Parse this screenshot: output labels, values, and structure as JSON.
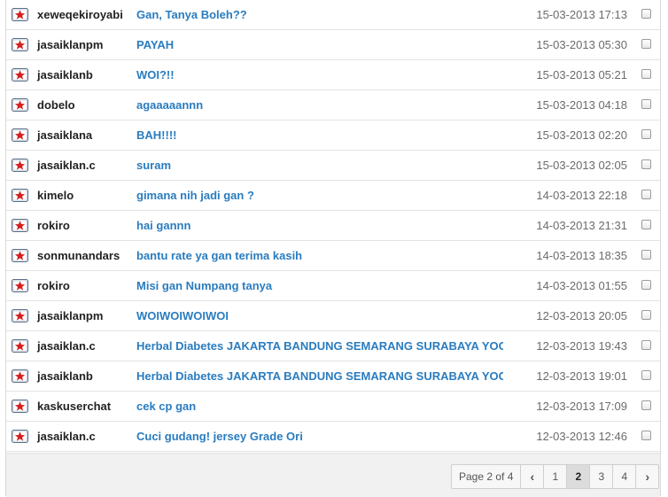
{
  "messages": [
    {
      "sender": "xeweqekiroyabi",
      "subject": "Gan, Tanya Boleh??",
      "date": "15-03-2013 17:13"
    },
    {
      "sender": "jasaiklanpm",
      "subject": "PAYAH",
      "date": "15-03-2013 05:30"
    },
    {
      "sender": "jasaiklanb",
      "subject": "WOI?!!",
      "date": "15-03-2013 05:21"
    },
    {
      "sender": "dobelo",
      "subject": "agaaaaannn",
      "date": "15-03-2013 04:18"
    },
    {
      "sender": "jasaiklana",
      "subject": "BAH!!!!",
      "date": "15-03-2013 02:20"
    },
    {
      "sender": "jasaiklan.c",
      "subject": "suram",
      "date": "15-03-2013 02:05"
    },
    {
      "sender": "kimelo",
      "subject": "gimana nih jadi gan ?",
      "date": "14-03-2013 22:18"
    },
    {
      "sender": "rokiro",
      "subject": "hai gannn",
      "date": "14-03-2013 21:31"
    },
    {
      "sender": "sonmunandars",
      "subject": "bantu rate ya gan terima kasih",
      "date": "14-03-2013 18:35"
    },
    {
      "sender": "rokiro",
      "subject": "Misi gan Numpang tanya",
      "date": "14-03-2013 01:55"
    },
    {
      "sender": "jasaiklanpm",
      "subject": "WOIWOIWOIWOI",
      "date": "12-03-2013 20:05"
    },
    {
      "sender": "jasaiklan.c",
      "subject": "Herbal Diabetes JAKARTA BANDUNG SEMARANG SURABAYA YOGYA",
      "date": "12-03-2013 19:43"
    },
    {
      "sender": "jasaiklanb",
      "subject": "Herbal Diabetes JAKARTA BANDUNG SEMARANG SURABAYA YOGYA",
      "date": "12-03-2013 19:01"
    },
    {
      "sender": "kaskuserchat",
      "subject": "cek cp gan",
      "date": "12-03-2013 17:09"
    },
    {
      "sender": "jasaiklan.c",
      "subject": "Cuci gudang! jersey Grade Ori",
      "date": "12-03-2013 12:46"
    }
  ],
  "pagination": {
    "info": "Page 2 of 4",
    "prev_icon": "‹",
    "next_icon": "›",
    "pages": [
      "1",
      "2",
      "3",
      "4"
    ],
    "current_page": "2"
  },
  "colors": {
    "link": "#2a7cbf",
    "icon_star": "#d61f1f"
  },
  "icon_name": "kaskus-star-envelope-icon"
}
